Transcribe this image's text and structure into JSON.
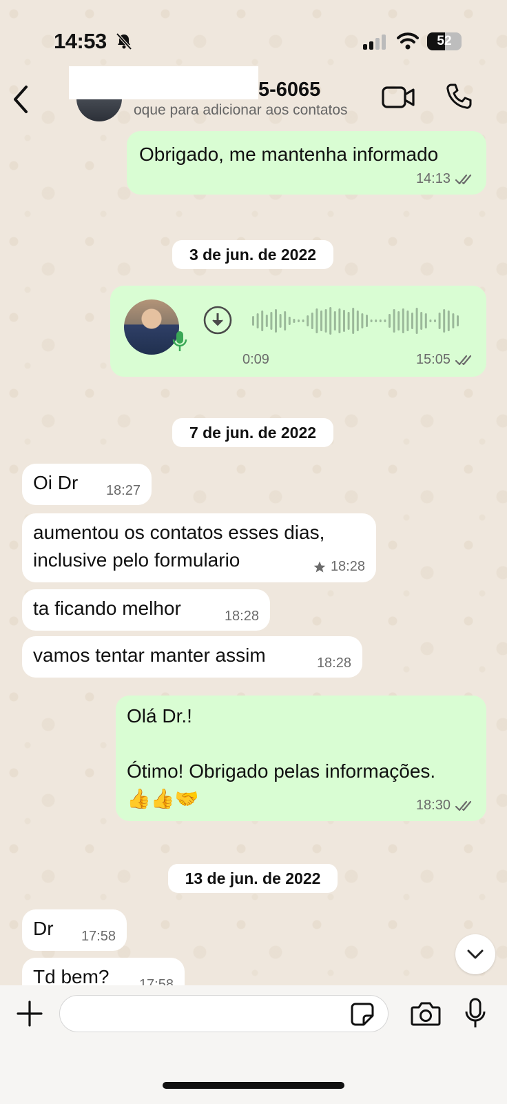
{
  "status_bar": {
    "time": "14:53",
    "battery": "52",
    "battery_level": 0.52
  },
  "header": {
    "contact_name": "5-6065",
    "contact_subtitle": "oque para adicionar aos contatos"
  },
  "messages": [
    {
      "kind": "out",
      "text": "Obrigado, me mantenha informado",
      "time": "14:13"
    },
    {
      "kind": "date",
      "text": "3 de jun. de 2022"
    },
    {
      "kind": "voice",
      "duration": "0:09",
      "time": "15:05"
    },
    {
      "kind": "date",
      "text": "7 de jun. de 2022"
    },
    {
      "kind": "in",
      "text": "Oi Dr",
      "time": "18:27"
    },
    {
      "kind": "in",
      "text": "aumentou os contatos esses dias,\ninclusive pelo formulario",
      "time": "18:28",
      "starred": true
    },
    {
      "kind": "in",
      "text": "ta ficando melhor",
      "time": "18:28"
    },
    {
      "kind": "in",
      "text": "vamos tentar manter assim",
      "time": "18:28"
    },
    {
      "kind": "out",
      "text": "Olá Dr.!\n\nÓtimo! Obrigado pelas informações.\n👍👍🤝",
      "time": "18:30"
    },
    {
      "kind": "date",
      "text": "13 de jun. de 2022"
    },
    {
      "kind": "in",
      "text": "Dr",
      "time": "17:58"
    },
    {
      "kind": "in",
      "text": "Td bem?",
      "time": "17:58"
    }
  ],
  "composer": {
    "placeholder": ""
  },
  "icons": {
    "back": "chevron-left-icon",
    "video": "video-camera-icon",
    "call": "phone-icon",
    "plus": "plus-icon",
    "sticker": "sticker-icon",
    "camera": "camera-icon",
    "mic": "microphone-icon",
    "scroll": "chevron-down-icon",
    "read": "double-check-icon",
    "star": "star-icon",
    "download": "download-icon",
    "muted": "bell-slash-icon"
  },
  "colors": {
    "outgoing": "#d9fdd3",
    "incoming": "#ffffff",
    "background": "#efeae2"
  }
}
